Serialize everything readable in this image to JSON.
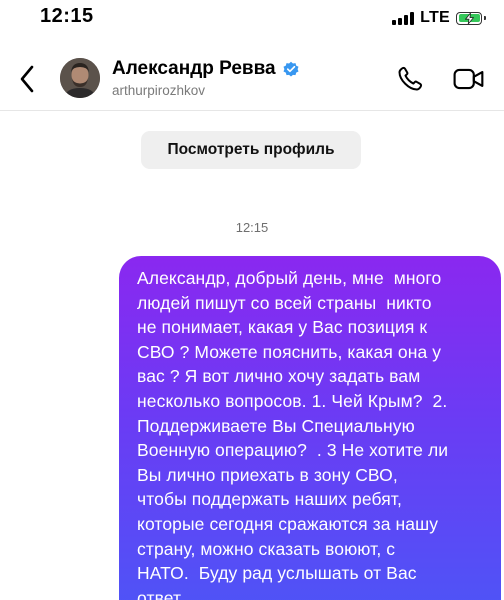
{
  "status_bar": {
    "time": "12:15",
    "network": "LTE",
    "battery_color": "#34c759"
  },
  "header": {
    "contact_name": "Александр Ревва",
    "username": "arthurpirozhkov",
    "verified": true,
    "icons": [
      "chevron-left-icon",
      "phone-icon",
      "video-camera-icon",
      "verified-badge-icon"
    ]
  },
  "chat": {
    "profile_button_label": "Посмотреть профиль",
    "timestamp": "12:15",
    "messages": [
      {
        "direction": "outgoing",
        "text": "Александр, добрый день, мне  много\nлюдей пишут со всей страны  никто\nне понимает, какая у Вас позиция к\nСВО ? Можете пояснить, какая она у\nвас ? Я вот лично хочу задать вам\nнесколько вопросов. 1. Чей Крым?  2.\nПоддерживаете Вы Специальную\nВоенную операцию?  . 3 Не хотите ли\nВы лично приехать в зону СВО,\nчтобы поддержать наших ребят,\nкоторые сегодня сражаются за нашу\nстрану, можно сказать воюют, с\nНАТО.  Буду рад услышать от Вас\nответ"
      }
    ]
  },
  "colors": {
    "bubble_gradient_top": "#8a28f0",
    "bubble_gradient_bottom": "#4c56f7",
    "verified_blue": "#3897f0",
    "profile_button_bg": "#efefef"
  }
}
